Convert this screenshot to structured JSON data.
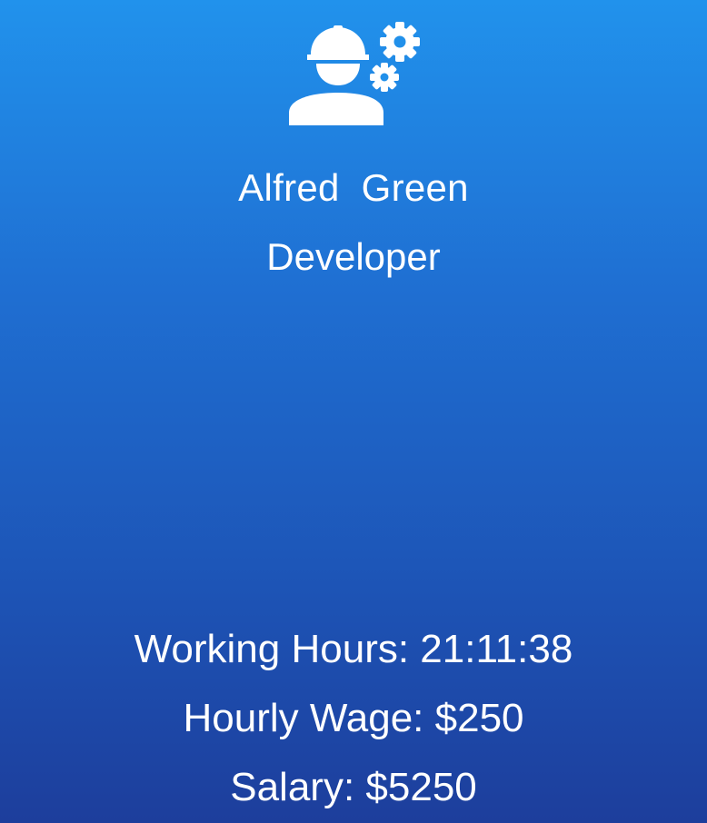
{
  "profile": {
    "icon": "construction-worker-gears-icon",
    "first_name": "Alfred",
    "last_name": "Green",
    "full_name": "Alfred  Green",
    "role": "Developer"
  },
  "stats": {
    "working_hours_label": "Working Hours: ",
    "working_hours_value": "21:11:38",
    "hourly_wage_label": "Hourly Wage: ",
    "hourly_wage_value": "$250",
    "salary_label": "Salary: ",
    "salary_value": "$5250"
  },
  "colors": {
    "background_top": "#2192ec",
    "background_bottom": "#1d3e9c",
    "text": "#ffffff"
  }
}
